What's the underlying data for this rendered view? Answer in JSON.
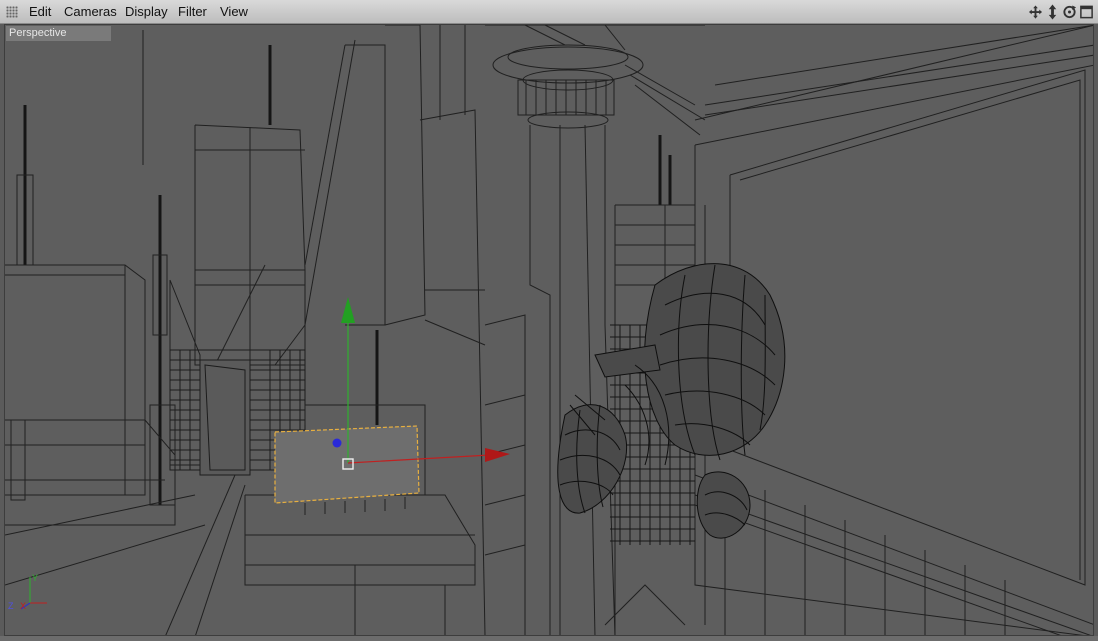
{
  "menu": {
    "items": [
      {
        "label": "Edit"
      },
      {
        "label": "Cameras"
      },
      {
        "label": "Display"
      },
      {
        "label": "Filter"
      },
      {
        "label": "View"
      }
    ]
  },
  "nav_icons": [
    "move-view-icon",
    "dolly-view-icon",
    "rotate-view-icon",
    "maximize-view-icon"
  ],
  "viewport": {
    "label": "Perspective",
    "axis_labels": {
      "z": "Z",
      "y": "Y",
      "x": "X"
    }
  },
  "colors": {
    "axis_x": "#c02020",
    "axis_y": "#2fb02f",
    "axis_z": "#2a2ad8",
    "selection": "#e8b040",
    "wireframe": "#1a1a1a",
    "background": "#5e5e5e"
  }
}
